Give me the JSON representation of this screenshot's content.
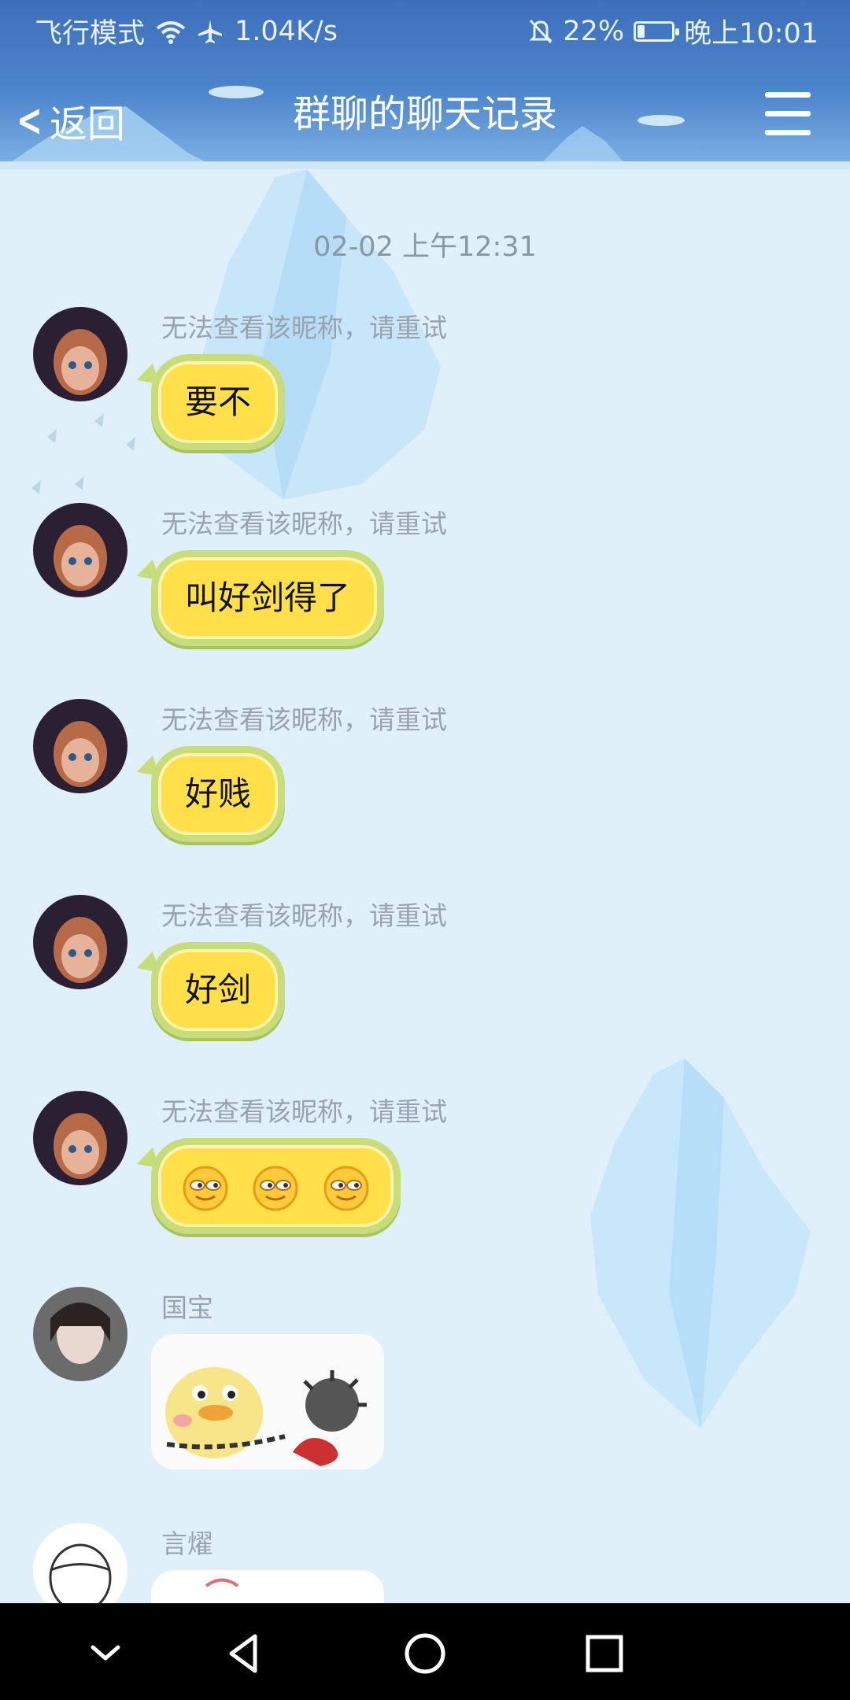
{
  "status_bar": {
    "left_text": "飞行模式",
    "speed": "1.04K/s",
    "battery": "22%",
    "battery_level": 0.22,
    "time": "晚上10:01",
    "icons": [
      "wifi-icon",
      "airplane-icon",
      "mute-bell-icon",
      "battery-icon"
    ]
  },
  "header": {
    "back_label": "返回",
    "title": "群聊的聊天记录",
    "menu_icon": "menu-icon"
  },
  "chat": {
    "timestamp": "02-02 上午12:31",
    "messages": [
      {
        "nick": "无法查看该昵称，请重试",
        "text": "要不"
      },
      {
        "nick": "无法查看该昵称，请重试",
        "text": "叫好剑得了"
      },
      {
        "nick": "无法查看该昵称，请重试",
        "text": "好贱"
      },
      {
        "nick": "无法查看该昵称，请重试",
        "text": "好剑"
      },
      {
        "nick": "无法查看该昵称，请重试",
        "emoji": "smirk-face-icon",
        "emoji_count": 3
      },
      {
        "nick": "国宝",
        "sticker": "duck-chain-sticker"
      },
      {
        "nick": "言燿",
        "sticker": "partial-sticker"
      }
    ]
  },
  "colors": {
    "header": "#4d86cc",
    "background": "#dff0fb",
    "bubble_fill": "#ffe04a",
    "bubble_border": "#c7dd7c",
    "nick": "#9aa3ab"
  },
  "navbar": {
    "icons": [
      "chevron-down-icon",
      "back-triangle-icon",
      "home-circle-icon",
      "recents-square-icon"
    ]
  }
}
